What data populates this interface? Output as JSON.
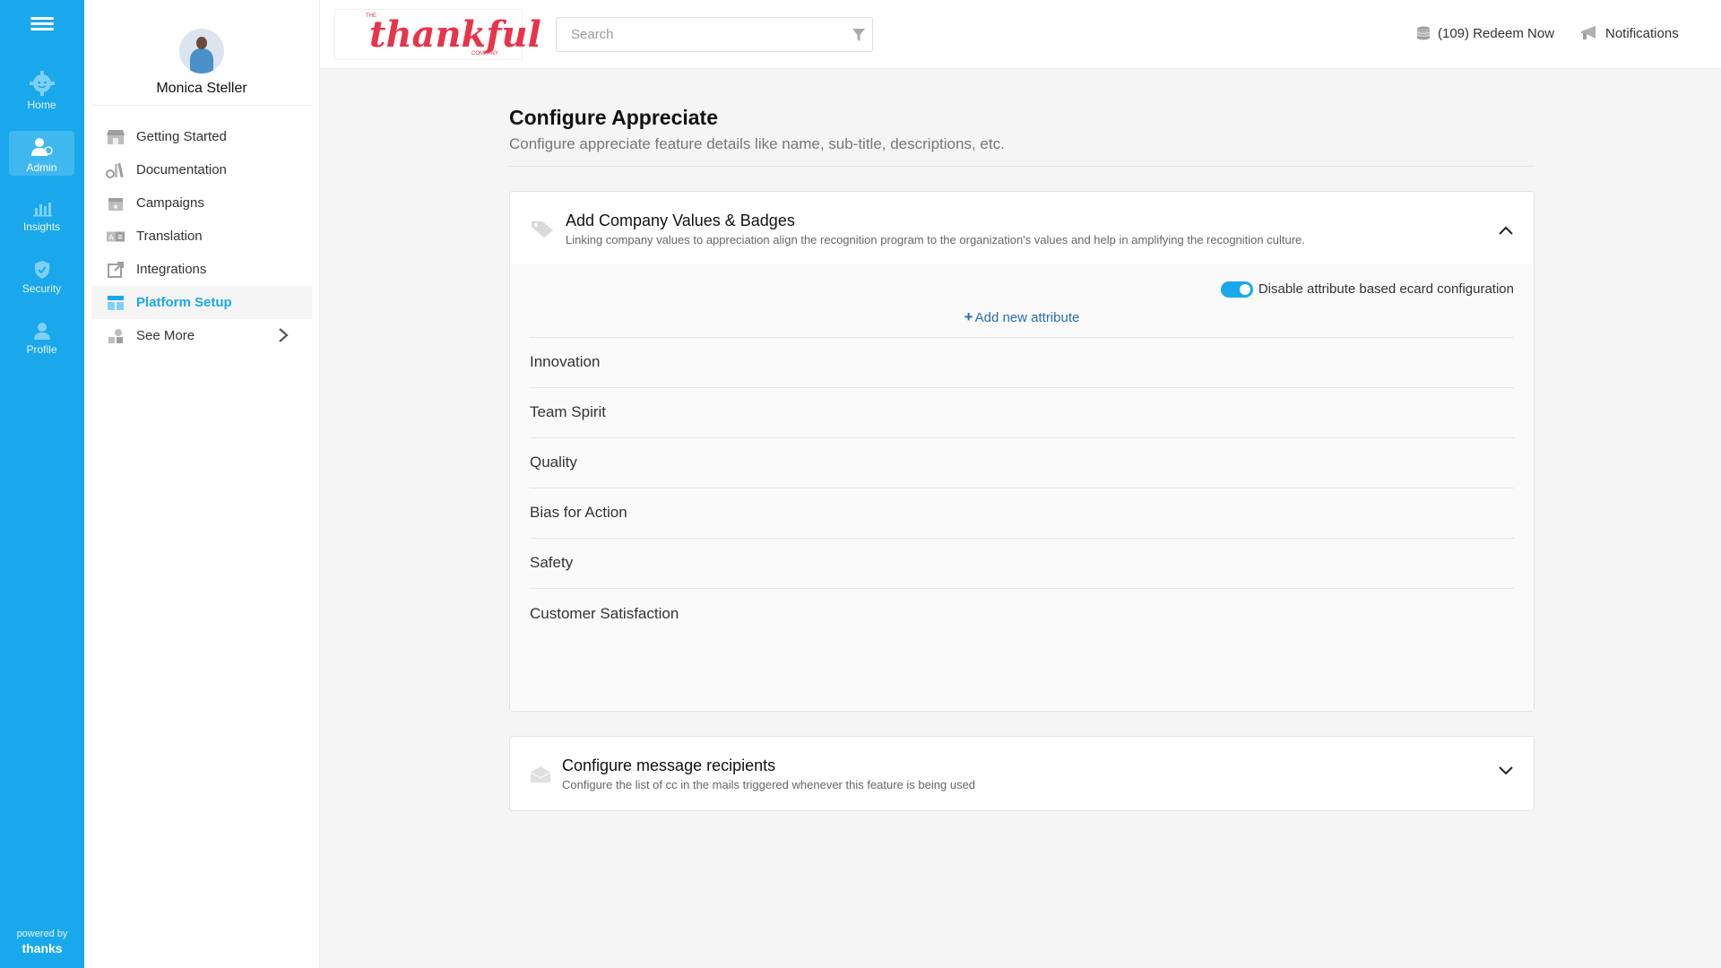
{
  "rail": {
    "items": [
      {
        "label": "Home",
        "icon": "home-gear-icon"
      },
      {
        "label": "Admin",
        "icon": "admin-icon"
      },
      {
        "label": "Insights",
        "icon": "chart-icon"
      },
      {
        "label": "Security",
        "icon": "shield-icon"
      },
      {
        "label": "Profile",
        "icon": "user-icon"
      }
    ],
    "active": "Admin",
    "footer_powered": "powered by",
    "footer_brand": "thanks"
  },
  "profile": {
    "name": "Monica Steller"
  },
  "sidebar": {
    "items": [
      {
        "label": "Getting Started",
        "icon": "store-icon"
      },
      {
        "label": "Documentation",
        "icon": "documents-icon"
      },
      {
        "label": "Campaigns",
        "icon": "calendar-icon"
      },
      {
        "label": "Translation",
        "icon": "translate-icon"
      },
      {
        "label": "Integrations",
        "icon": "external-link-icon"
      },
      {
        "label": "Platform Setup",
        "icon": "layout-icon"
      },
      {
        "label": "See More",
        "icon": "shapes-icon"
      }
    ],
    "active": "Platform Setup"
  },
  "topbar": {
    "logo_text": "thankful",
    "logo_the": "THE",
    "logo_company": "COMPANY",
    "search_placeholder": "Search",
    "redeem_label": "(109) Redeem Now",
    "notifications_label": "Notifications"
  },
  "page": {
    "title": "Configure Appreciate",
    "subtitle": "Configure appreciate feature details like name, sub-title, descriptions, etc."
  },
  "values_card": {
    "title": "Add Company Values & Badges",
    "description": "Linking company values to appreciation align the recognition program to the organization's values and help in amplifying the recognition culture.",
    "switch_label": "Disable attribute based ecard configuration",
    "switch_on": true,
    "add_label": "Add new attribute",
    "attributes": [
      "Innovation",
      "Team Spirit",
      "Quality",
      "Bias for Action",
      "Safety",
      "Customer Satisfaction"
    ]
  },
  "recipients_card": {
    "title": "Configure message recipients",
    "description": "Configure the list of cc in the mails triggered whenever this feature is being used"
  },
  "colors": {
    "primary": "#1aa8ec",
    "brand_red": "#e8334a",
    "link_blue": "#2b6cb0"
  }
}
